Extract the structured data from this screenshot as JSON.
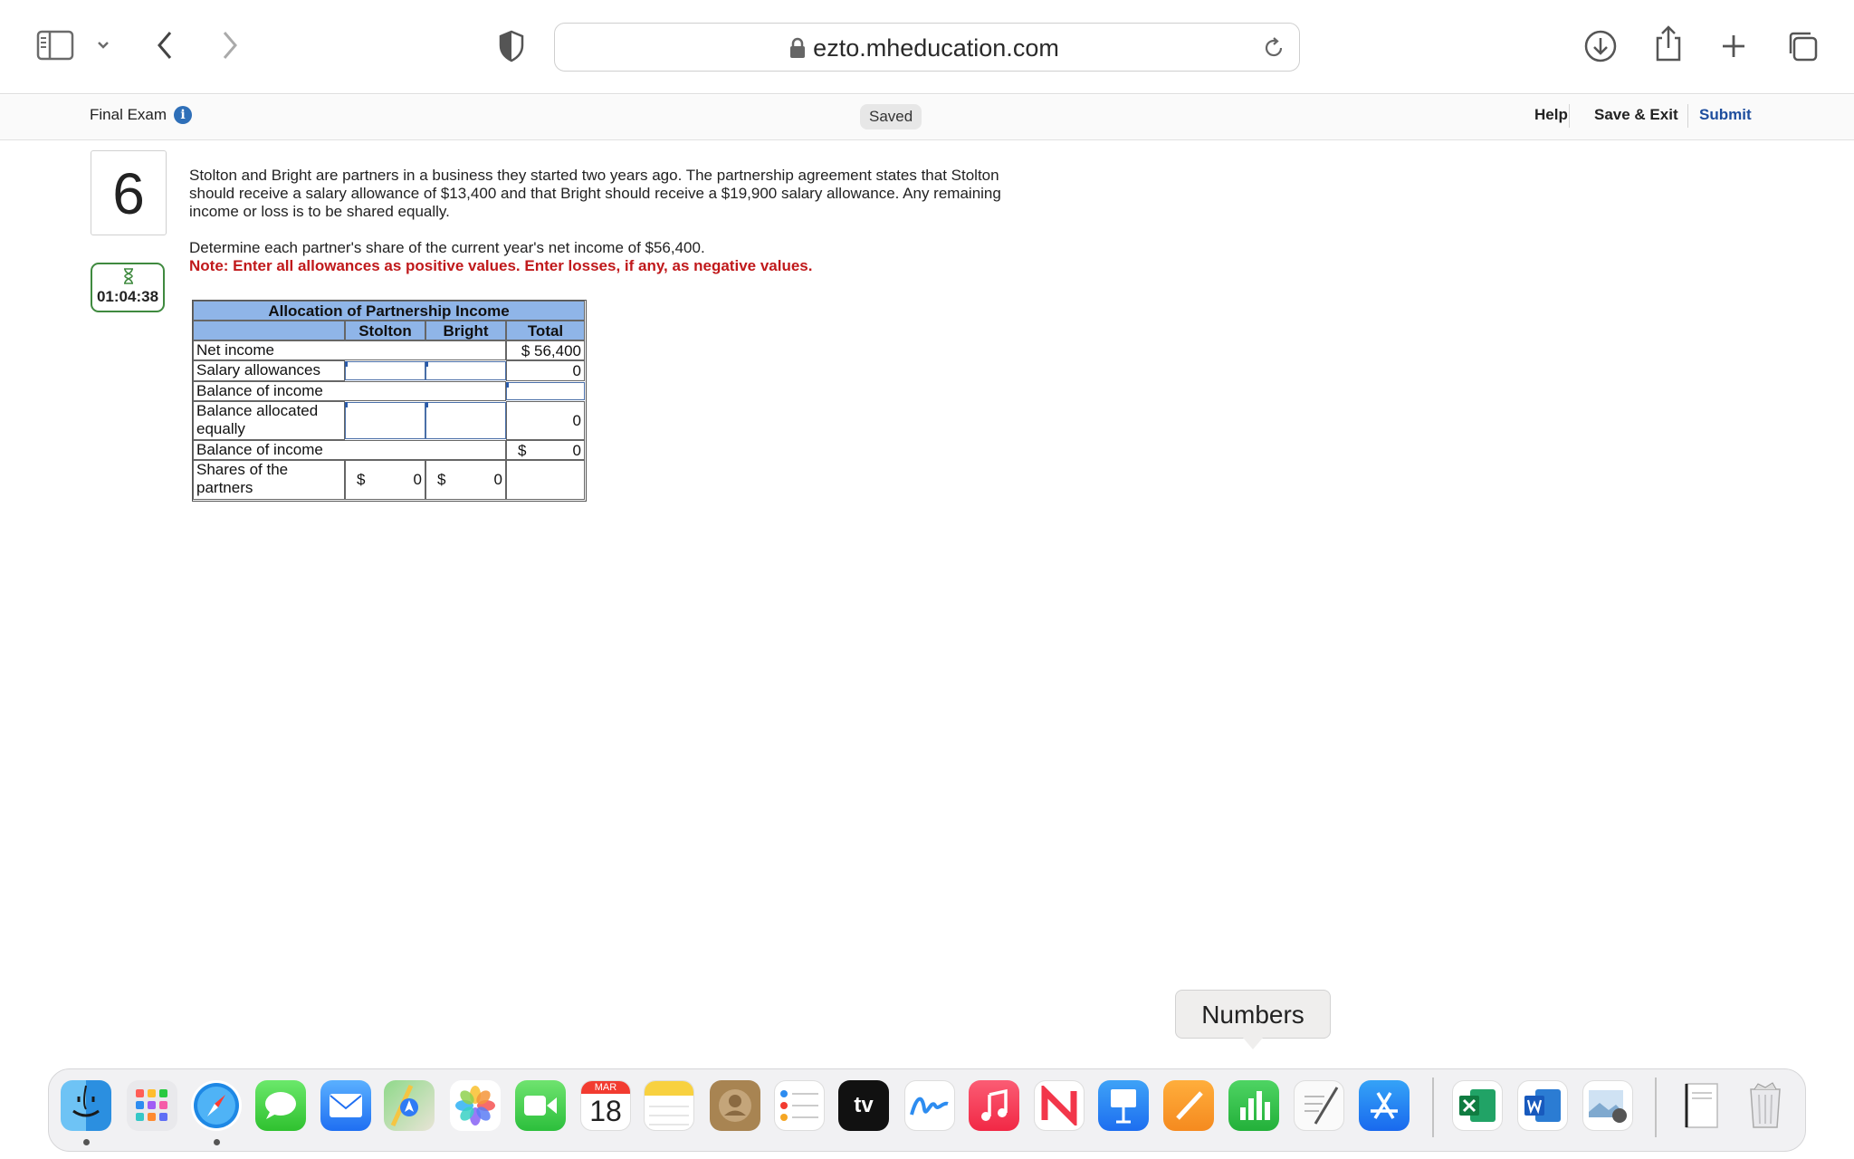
{
  "browser": {
    "url": "ezto.mheducation.com"
  },
  "exam": {
    "title": "Final Exam",
    "saved": "Saved",
    "help": "Help",
    "save_exit": "Save & Exit",
    "submit": "Submit"
  },
  "question": {
    "number": "6",
    "timer": "01:04:38",
    "text": "Stolton and Bright are partners in a business they started two years ago. The partnership agreement states that Stolton should receive a salary allowance of $13,400 and that Bright should receive a $19,900 salary allowance. Any remaining income or loss is to be shared equally.",
    "task": "Determine each partner's share of the current year's net income of $56,400.",
    "note": "Note: Enter all allowances as positive values. Enter losses, if any, as negative values."
  },
  "table": {
    "title": "Allocation of Partnership Income",
    "col_stolton": "Stolton",
    "col_bright": "Bright",
    "col_total": "Total",
    "rows": {
      "net_income": {
        "label": "Net income",
        "total": "$ 56,400"
      },
      "salary": {
        "label": "Salary allowances",
        "total": "0"
      },
      "balance1": {
        "label": "Balance of income"
      },
      "allocated": {
        "label_1": "Balance allocated",
        "label_2": "equally",
        "total": "0"
      },
      "balance2": {
        "label": "Balance of income",
        "total_sign": "$",
        "total": "0"
      },
      "shares": {
        "label_1": "Shares of the",
        "label_2": "partners",
        "sign": "$",
        "stolton": "0",
        "bright": "0"
      }
    }
  },
  "dock": {
    "tooltip": "Numbers",
    "calendar_month": "MAR",
    "calendar_day": "18",
    "apps": [
      "finder",
      "launchpad",
      "safari",
      "messages",
      "mail",
      "maps",
      "photos",
      "facetime",
      "calendar",
      "notes",
      "contacts",
      "reminders",
      "apple-tv",
      "freeform",
      "music",
      "news",
      "keynote",
      "pages",
      "numbers",
      "textedit",
      "app-store",
      "excel",
      "word",
      "preview",
      "document",
      "trash"
    ]
  }
}
